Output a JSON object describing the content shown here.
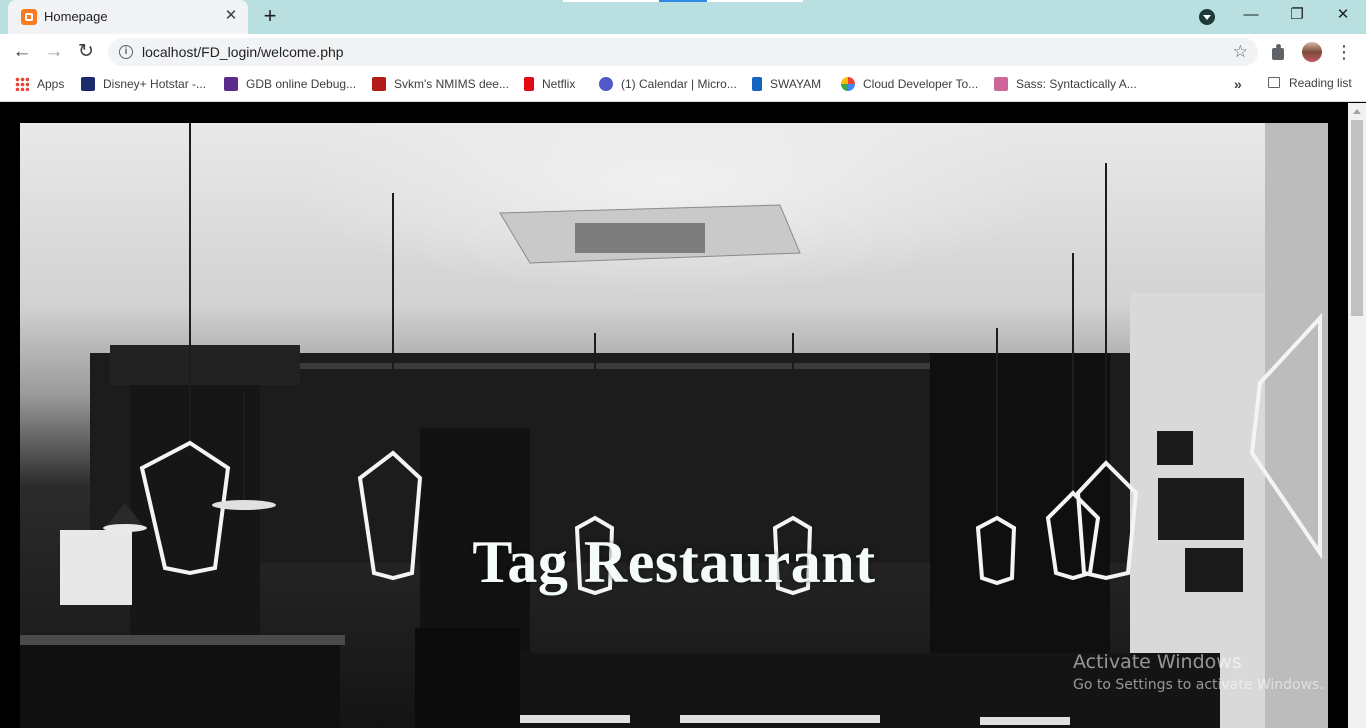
{
  "tab": {
    "title": "Homepage",
    "favicon": "xampp-icon",
    "close": "✕"
  },
  "tabstrip": {
    "new_tab": "+",
    "accent": "#b9dfe0"
  },
  "window": {
    "minimize": "—",
    "restore": "❐",
    "close": "✕"
  },
  "toolbar": {
    "back": "←",
    "forward": "→",
    "reload": "↻",
    "url": "localhost/FD_login/welcome.php",
    "info": "i",
    "star": "☆",
    "menu": "⋮"
  },
  "bookmarks": [
    {
      "label": "Apps",
      "icon": "apps-grid-icon"
    },
    {
      "label": "Disney+ Hotstar -...",
      "icon": "hotstar-icon",
      "color": "#1b2a6b"
    },
    {
      "label": "GDB online Debug...",
      "icon": "gdb-icon",
      "color": "#5a2b8a"
    },
    {
      "label": "Svkm's NMIMS dee...",
      "icon": "nmims-icon",
      "color": "#b31b1b"
    },
    {
      "label": "Netflix",
      "icon": "netflix-icon",
      "color": "#e50914"
    },
    {
      "label": "(1) Calendar | Micro...",
      "icon": "teams-icon",
      "color": "#5059c9"
    },
    {
      "label": "SWAYAM",
      "icon": "swayam-icon",
      "color": "#1565c0"
    },
    {
      "label": "Cloud Developer To...",
      "icon": "google-cloud-icon",
      "color": "#fbbc04"
    },
    {
      "label": "Sass: Syntactically A...",
      "icon": "sass-icon",
      "color": "#cd6799"
    }
  ],
  "bookmarks_more": "»",
  "reading_list": "Reading list",
  "page": {
    "hero_title": "Tag Restaurant"
  },
  "watermark": {
    "line1": "Activate Windows",
    "line2": "Go to Settings to activate Windows."
  }
}
